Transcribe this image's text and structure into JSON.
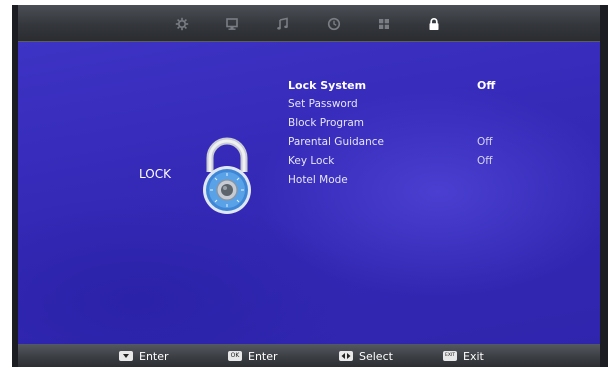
{
  "tabs": [
    {
      "icon": "picture-settings-icon",
      "active": false
    },
    {
      "icon": "screen-icon",
      "active": false
    },
    {
      "icon": "music-note-icon",
      "active": false
    },
    {
      "icon": "clock-icon",
      "active": false
    },
    {
      "icon": "grid-icon",
      "active": false
    },
    {
      "icon": "lock-icon",
      "active": true
    }
  ],
  "section": {
    "title": "LOCK",
    "graphic": "padlock-dial-icon"
  },
  "menu": [
    {
      "label": "Lock System",
      "value": "Off",
      "selected": true
    },
    {
      "label": "Set Password",
      "value": ""
    },
    {
      "label": "Block Program",
      "value": ""
    },
    {
      "label": "Parental Guidance",
      "value": "Off"
    },
    {
      "label": "Key Lock",
      "value": "Off"
    },
    {
      "label": "Hotel Mode",
      "value": ""
    }
  ],
  "footer": [
    {
      "key": "",
      "key_icon": "down-arrow-key",
      "label": "Enter"
    },
    {
      "key": "OK",
      "key_icon": "ok-key",
      "label": "Enter"
    },
    {
      "key": "",
      "key_icon": "left-right-key",
      "label": "Select"
    },
    {
      "key": "EXIT",
      "key_icon": "exit-key",
      "label": "Exit"
    }
  ],
  "colors": {
    "background": "#3529b8",
    "bar": "#3a3d42",
    "text": "#ffffff"
  }
}
